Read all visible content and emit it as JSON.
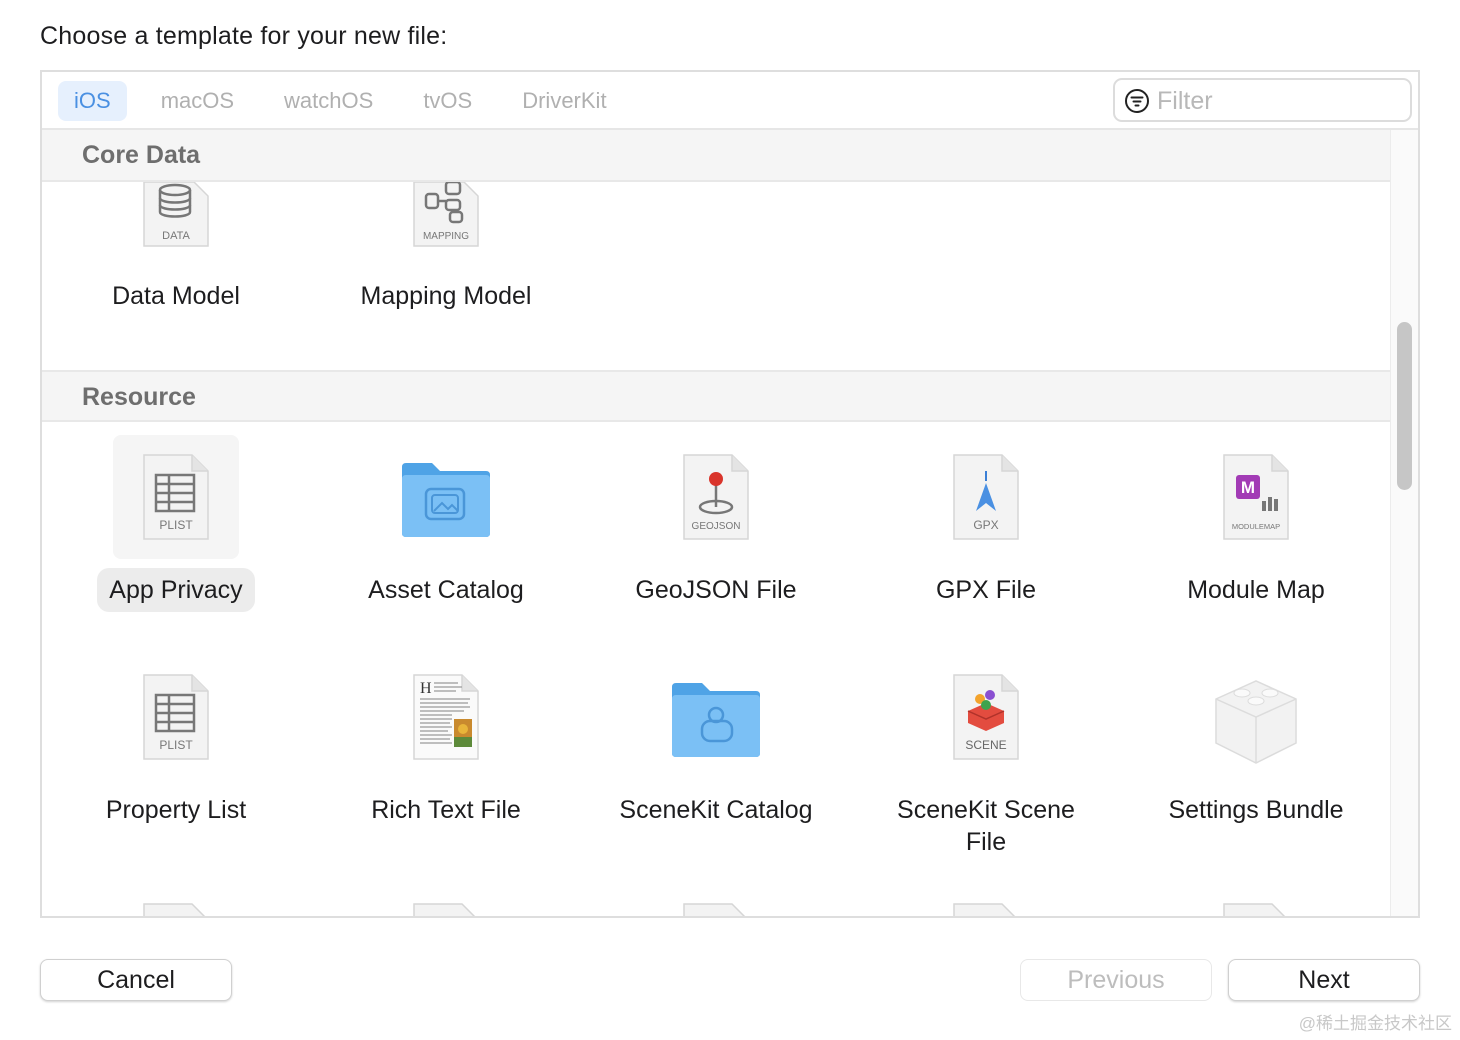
{
  "title": "Choose a template for your new file:",
  "tabs": [
    {
      "label": "iOS",
      "active": true
    },
    {
      "label": "macOS",
      "active": false
    },
    {
      "label": "watchOS",
      "active": false
    },
    {
      "label": "tvOS",
      "active": false
    },
    {
      "label": "DriverKit",
      "active": false
    }
  ],
  "filter": {
    "placeholder": "Filter",
    "value": ""
  },
  "sections": {
    "core_data": {
      "title": "Core Data",
      "items": [
        {
          "label": "Data Model",
          "badge": "DATA",
          "icon": "database-icon"
        },
        {
          "label": "Mapping Model",
          "badge": "MAPPING",
          "icon": "mapping-icon"
        }
      ]
    },
    "resource": {
      "title": "Resource",
      "items": [
        {
          "label": "App Privacy",
          "badge": "PLIST",
          "icon": "plist-icon",
          "selected": true
        },
        {
          "label": "Asset Catalog",
          "badge": "",
          "icon": "folder-photo-icon"
        },
        {
          "label": "GeoJSON File",
          "badge": "GEOJSON",
          "icon": "map-pin-icon"
        },
        {
          "label": "GPX File",
          "badge": "GPX",
          "icon": "gpx-arrow-icon"
        },
        {
          "label": "Module Map",
          "badge": "MODULEMAP",
          "icon": "modulemap-icon"
        },
        {
          "label": "Property List",
          "badge": "PLIST",
          "icon": "plist-icon"
        },
        {
          "label": "Rich Text File",
          "badge": "",
          "icon": "rich-text-icon"
        },
        {
          "label": "SceneKit Catalog",
          "badge": "",
          "icon": "folder-scenekit-icon"
        },
        {
          "label_line1": "SceneKit Scene",
          "label_line2": "File",
          "badge": "SCENE",
          "icon": "scene-icon"
        },
        {
          "label": "Settings Bundle",
          "badge": "",
          "icon": "settings-bundle-icon"
        }
      ]
    }
  },
  "buttons": {
    "cancel": "Cancel",
    "previous": "Previous",
    "next": "Next"
  },
  "watermark": "@稀土掘金技术社区",
  "colors": {
    "accent": "#4a90e2",
    "tab_active_bg": "#e6f0fd",
    "folder_blue": "#6fb7f0",
    "pin_red": "#d9342b",
    "modulemap_purple": "#a23bb5"
  }
}
